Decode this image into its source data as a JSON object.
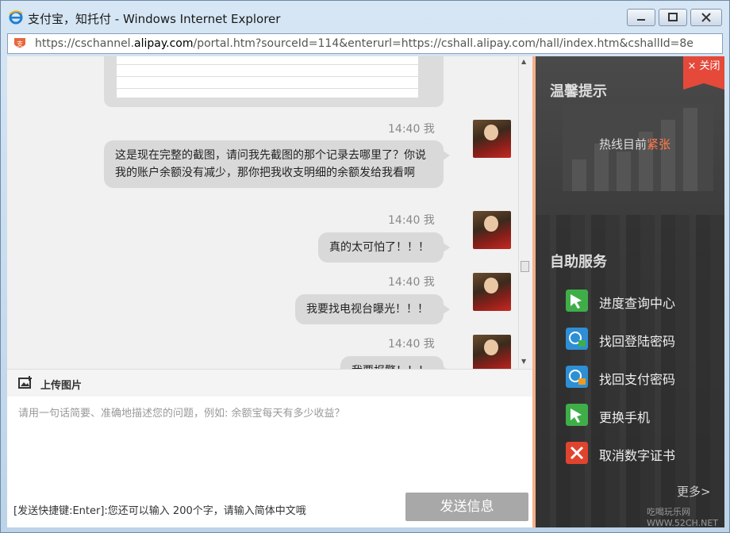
{
  "window": {
    "title": "支付宝，知托付 - Windows Internet Explorer",
    "address_prefix": "https://cschannel.",
    "address_domain": "alipay.com",
    "address_suffix": "/portal.htm?sourceId=114&enterurl=https://cshall.alipay.com/hall/index.htm&cshallId=8e"
  },
  "chat": {
    "messages": [
      {
        "time": "14:40 我",
        "text": "这是现在完整的截图，请问我先截图的那个记录去哪里了？你说我的账户余额没有减少，那你把我收支明细的余额发给我看啊"
      },
      {
        "time": "14:40 我",
        "text": "真的太可怕了！！！"
      },
      {
        "time": "14:40 我",
        "text": "我要找电视台曝光！！！"
      },
      {
        "time": "14:40 我",
        "text": "我要报警！！！"
      }
    ]
  },
  "composer": {
    "upload_label": "上传图片",
    "placeholder": "请用一句话简要、准确地描述您的问题，例如: 余额宝每天有多少收益？",
    "hint": "[发送快捷键:Enter]:您还可以输入 200个字，请输入简体中文哦",
    "send_label": "发送信息"
  },
  "sidebar": {
    "close_label": "× 关闭",
    "tips_title": "温馨提示",
    "hotline_prefix": "热线目前",
    "hotline_status": "紧张",
    "self_service_title": "自助服务",
    "services": [
      {
        "label": "进度查询中心",
        "icon": "search-progress-icon",
        "color": "#3fae49"
      },
      {
        "label": "找回登陆密码",
        "icon": "lock-icon",
        "color": "#2d8fd5"
      },
      {
        "label": "找回支付密码",
        "icon": "key-icon",
        "color": "#2d8fd5"
      },
      {
        "label": "更换手机",
        "icon": "phone-icon",
        "color": "#3fae49"
      },
      {
        "label": "取消数字证书",
        "icon": "certificate-cancel-icon",
        "color": "#e0442e"
      }
    ],
    "more_label": "更多>",
    "watermark": "吃喝玩乐网 WWW.52CH.NET"
  }
}
